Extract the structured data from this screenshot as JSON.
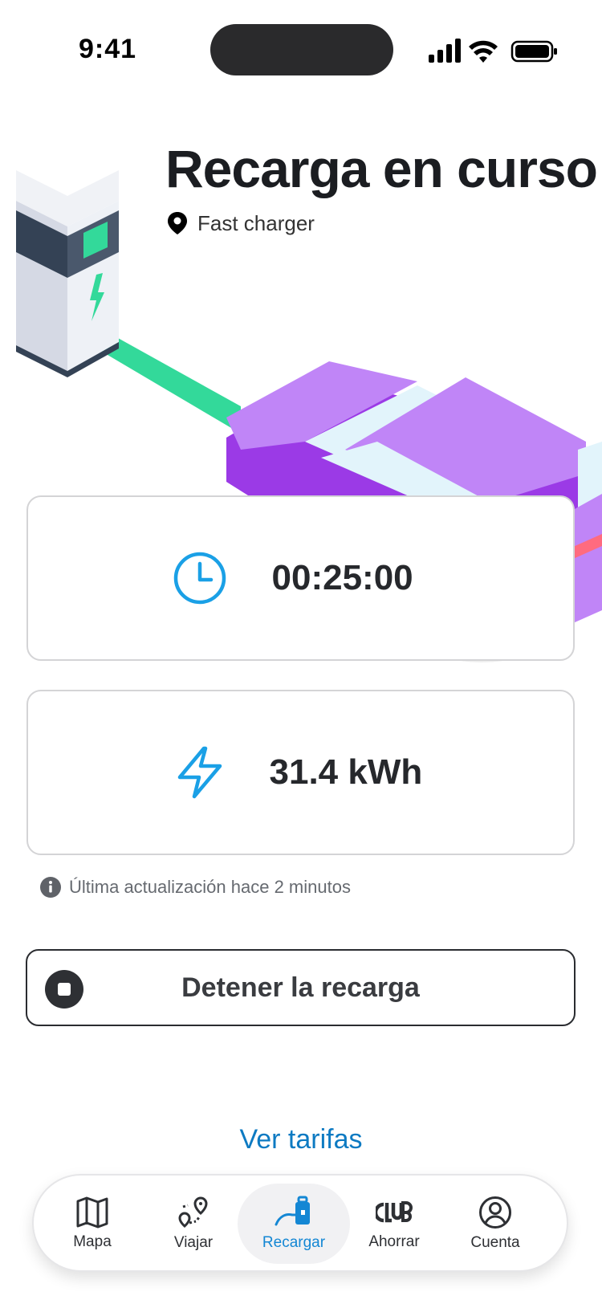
{
  "status_bar": {
    "time": "9:41"
  },
  "header": {
    "title": "Recarga en curso",
    "location": "Fast charger"
  },
  "cards": {
    "duration": "00:25:00",
    "energy": "31.4 kWh"
  },
  "update_notice": "Última actualización hace 2 minutos",
  "stop_button": {
    "label": "Detener la recarga"
  },
  "rates_link": "Ver tarifas",
  "bottom_nav": {
    "items": [
      {
        "label": "Mapa",
        "icon": "map-icon"
      },
      {
        "label": "Viajar",
        "icon": "route-icon"
      },
      {
        "label": "Recargar",
        "icon": "charging-icon"
      },
      {
        "label": "Ahorrar",
        "icon": "club-icon"
      },
      {
        "label": "Cuenta",
        "icon": "account-icon"
      }
    ],
    "active": "Recargar"
  },
  "colors": {
    "accent": "#1487d4",
    "link": "#0d7ac2",
    "car_purple": "#c085f7",
    "cable_green": "#33d99a"
  }
}
